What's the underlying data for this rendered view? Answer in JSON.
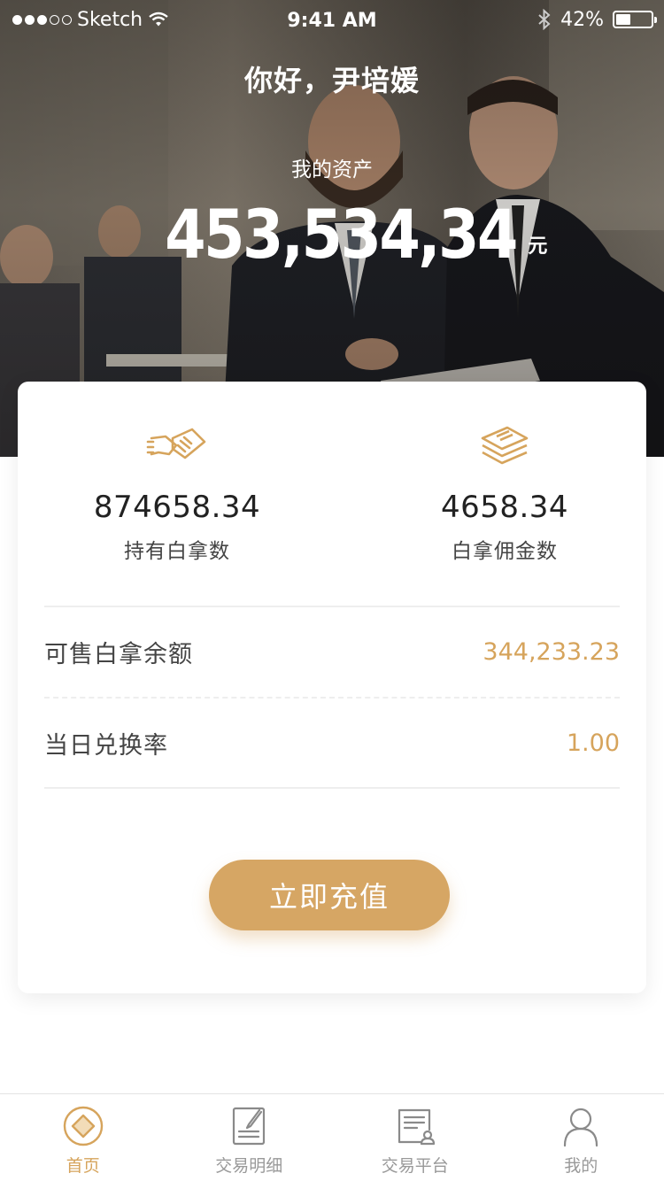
{
  "status_bar": {
    "carrier": "Sketch",
    "time": "9:41 AM",
    "battery_text": "42%",
    "battery_level": 0.42
  },
  "hero": {
    "greeting": "你好，尹培媛",
    "asset_label": "我的资产",
    "asset_value": "453,534,34",
    "asset_unit": "元"
  },
  "stats": [
    {
      "icon": "handshake-document-icon",
      "value": "874658.34",
      "label": "持有白拿数"
    },
    {
      "icon": "stacked-cards-icon",
      "value": "4658.34",
      "label": "白拿佣金数"
    }
  ],
  "rows": [
    {
      "label": "可售白拿余额",
      "value": "344,233.23"
    },
    {
      "label": "当日兑换率",
      "value": "1.00"
    }
  ],
  "cta_label": "立即充值",
  "tabs": [
    {
      "icon": "home-diamond-icon",
      "label": "首页",
      "active": true
    },
    {
      "icon": "transaction-detail-icon",
      "label": "交易明细",
      "active": false
    },
    {
      "icon": "trading-platform-icon",
      "label": "交易平台",
      "active": false
    },
    {
      "icon": "user-profile-icon",
      "label": "我的",
      "active": false
    }
  ],
  "colors": {
    "accent": "#d6a45c",
    "button": "#d6a664",
    "text_dark": "#222222",
    "text_muted": "#999999"
  }
}
